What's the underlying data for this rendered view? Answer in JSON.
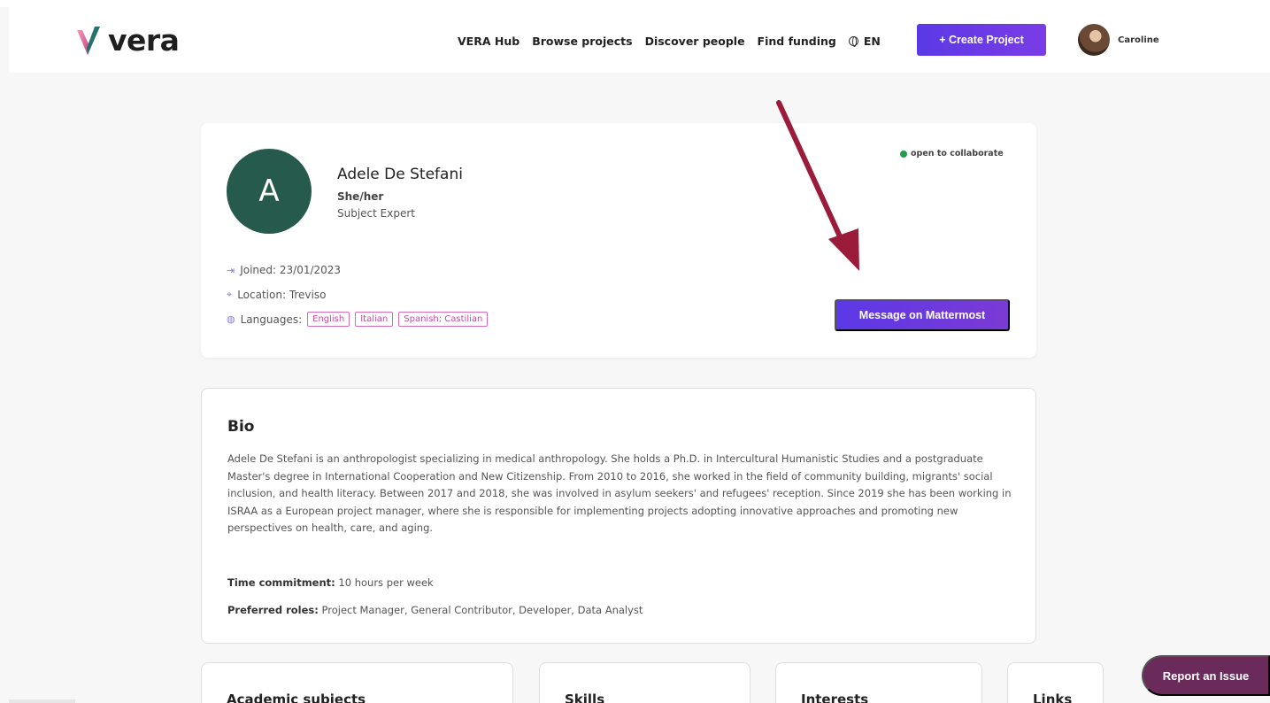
{
  "brand": {
    "name": "vera"
  },
  "nav": {
    "links": [
      "VERA Hub",
      "Browse projects",
      "Discover people",
      "Find funding"
    ],
    "language": "EN",
    "create_label": "+ Create Project",
    "user_name": "Caroline"
  },
  "profile": {
    "initial": "A",
    "name": "Adele De Stefani",
    "pronouns": "She/her",
    "role": "Subject Expert",
    "status": "open to collaborate",
    "joined": "Joined: 23/01/2023",
    "location": "Location: Treviso",
    "languages_label": "Languages:",
    "languages": [
      "English",
      "Italian",
      "Spanish; Castilian"
    ],
    "message_label": "Message on Mattermost"
  },
  "bio": {
    "title": "Bio",
    "text": "Adele De Stefani is an anthropologist specializing in medical anthropology. She holds a Ph.D. in Intercultural Humanistic Studies and a postgraduate Master's degree in International Cooperation and New Citizenship. From 2010 to 2016, she worked in the field of community building, migrants' social inclusion, and health literacy. Between 2017 and 2018, she was involved in asylum seekers' and refugees' reception. Since 2019 she has been working in ISRAA as a European project manager, where she is responsible for implementing projects adopting innovative approaches and promoting new perspectives on health, care, and aging.",
    "time_label": "Time commitment:",
    "time_value": "10 hours per week",
    "roles_label": "Preferred roles:",
    "roles_value": "Project Manager, General Contributor, Developer, Data Analyst"
  },
  "sections": [
    "Academic subjects",
    "Skills",
    "Interests",
    "Links"
  ],
  "report_label": "Report an Issue",
  "colors": {
    "accent": "#5b39e6",
    "avatar": "#265a4c",
    "report": "#6a2b5a",
    "tag": "#c44ba0",
    "arrow": "#9b1b3a"
  }
}
